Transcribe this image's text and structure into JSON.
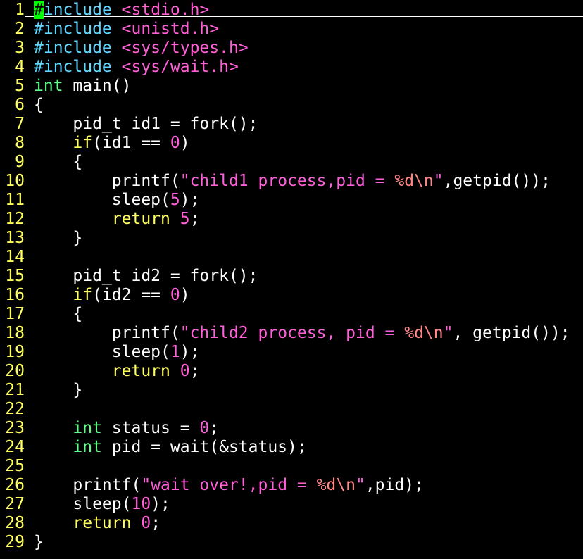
{
  "editor": {
    "colors": {
      "background": "#000000",
      "line_number": "#ffff5f",
      "plain": "#ffffff",
      "preproc": "#5fd7ff",
      "include_path": "#ff5fd7",
      "type": "#5fff87",
      "keyword": "#ffff5f",
      "number": "#ff5fd7",
      "string": "#ff5fd7",
      "special_char": "#ff8787",
      "cursor": "#00ff00"
    },
    "cursor": {
      "line": 1,
      "column": 1
    },
    "lines": [
      {
        "num": "1",
        "tokens": [
          {
            "t": "#",
            "c": "cursor"
          },
          {
            "t": "include",
            "c": "preproc"
          },
          {
            "t": " ",
            "c": "plain"
          },
          {
            "t": "<stdio.h>",
            "c": "include"
          }
        ]
      },
      {
        "num": "2",
        "tokens": [
          {
            "t": "#include",
            "c": "preproc"
          },
          {
            "t": " ",
            "c": "plain"
          },
          {
            "t": "<unistd.h>",
            "c": "include"
          }
        ]
      },
      {
        "num": "3",
        "tokens": [
          {
            "t": "#include",
            "c": "preproc"
          },
          {
            "t": " ",
            "c": "plain"
          },
          {
            "t": "<sys/types.h>",
            "c": "include"
          }
        ]
      },
      {
        "num": "4",
        "tokens": [
          {
            "t": "#include",
            "c": "preproc"
          },
          {
            "t": " ",
            "c": "plain"
          },
          {
            "t": "<sys/wait.h>",
            "c": "include"
          }
        ]
      },
      {
        "num": "5",
        "tokens": [
          {
            "t": "int",
            "c": "type"
          },
          {
            "t": " main()",
            "c": "plain"
          }
        ]
      },
      {
        "num": "6",
        "tokens": [
          {
            "t": "{",
            "c": "plain"
          }
        ]
      },
      {
        "num": "7",
        "tokens": [
          {
            "t": "    pid_t id1 = fork();",
            "c": "plain"
          }
        ]
      },
      {
        "num": "8",
        "tokens": [
          {
            "t": "    ",
            "c": "plain"
          },
          {
            "t": "if",
            "c": "keyword"
          },
          {
            "t": "(id1 == ",
            "c": "plain"
          },
          {
            "t": "0",
            "c": "number"
          },
          {
            "t": ")",
            "c": "plain"
          }
        ]
      },
      {
        "num": "9",
        "tokens": [
          {
            "t": "    {",
            "c": "plain"
          }
        ]
      },
      {
        "num": "10",
        "tokens": [
          {
            "t": "        printf(",
            "c": "plain"
          },
          {
            "t": "\"child1 process,pid = ",
            "c": "string"
          },
          {
            "t": "%d\\n",
            "c": "special"
          },
          {
            "t": "\"",
            "c": "string"
          },
          {
            "t": ",getpid());",
            "c": "plain"
          }
        ]
      },
      {
        "num": "11",
        "tokens": [
          {
            "t": "        sleep(",
            "c": "plain"
          },
          {
            "t": "5",
            "c": "number"
          },
          {
            "t": ");",
            "c": "plain"
          }
        ]
      },
      {
        "num": "12",
        "tokens": [
          {
            "t": "        ",
            "c": "plain"
          },
          {
            "t": "return",
            "c": "keyword"
          },
          {
            "t": " ",
            "c": "plain"
          },
          {
            "t": "5",
            "c": "number"
          },
          {
            "t": ";",
            "c": "plain"
          }
        ]
      },
      {
        "num": "13",
        "tokens": [
          {
            "t": "    }",
            "c": "plain"
          }
        ]
      },
      {
        "num": "14",
        "tokens": []
      },
      {
        "num": "15",
        "tokens": [
          {
            "t": "    pid_t id2 = fork();",
            "c": "plain"
          }
        ]
      },
      {
        "num": "16",
        "tokens": [
          {
            "t": "    ",
            "c": "plain"
          },
          {
            "t": "if",
            "c": "keyword"
          },
          {
            "t": "(id2 == ",
            "c": "plain"
          },
          {
            "t": "0",
            "c": "number"
          },
          {
            "t": ")",
            "c": "plain"
          }
        ]
      },
      {
        "num": "17",
        "tokens": [
          {
            "t": "    {",
            "c": "plain"
          }
        ]
      },
      {
        "num": "18",
        "tokens": [
          {
            "t": "        printf(",
            "c": "plain"
          },
          {
            "t": "\"child2 process, pid = ",
            "c": "string"
          },
          {
            "t": "%d\\n",
            "c": "special"
          },
          {
            "t": "\"",
            "c": "string"
          },
          {
            "t": ", getpid());",
            "c": "plain"
          }
        ]
      },
      {
        "num": "19",
        "tokens": [
          {
            "t": "        sleep(",
            "c": "plain"
          },
          {
            "t": "1",
            "c": "number"
          },
          {
            "t": ");",
            "c": "plain"
          }
        ]
      },
      {
        "num": "20",
        "tokens": [
          {
            "t": "        ",
            "c": "plain"
          },
          {
            "t": "return",
            "c": "keyword"
          },
          {
            "t": " ",
            "c": "plain"
          },
          {
            "t": "0",
            "c": "number"
          },
          {
            "t": ";",
            "c": "plain"
          }
        ]
      },
      {
        "num": "21",
        "tokens": [
          {
            "t": "    }",
            "c": "plain"
          }
        ]
      },
      {
        "num": "22",
        "tokens": []
      },
      {
        "num": "23",
        "tokens": [
          {
            "t": "    ",
            "c": "plain"
          },
          {
            "t": "int",
            "c": "type"
          },
          {
            "t": " status = ",
            "c": "plain"
          },
          {
            "t": "0",
            "c": "number"
          },
          {
            "t": ";",
            "c": "plain"
          }
        ]
      },
      {
        "num": "24",
        "tokens": [
          {
            "t": "    ",
            "c": "plain"
          },
          {
            "t": "int",
            "c": "type"
          },
          {
            "t": " pid = wait(&status);",
            "c": "plain"
          }
        ]
      },
      {
        "num": "25",
        "tokens": []
      },
      {
        "num": "26",
        "tokens": [
          {
            "t": "    printf(",
            "c": "plain"
          },
          {
            "t": "\"wait over!,pid = ",
            "c": "string"
          },
          {
            "t": "%d\\n",
            "c": "special"
          },
          {
            "t": "\"",
            "c": "string"
          },
          {
            "t": ",pid);",
            "c": "plain"
          }
        ]
      },
      {
        "num": "27",
        "tokens": [
          {
            "t": "    sleep(",
            "c": "plain"
          },
          {
            "t": "10",
            "c": "number"
          },
          {
            "t": ");",
            "c": "plain"
          }
        ]
      },
      {
        "num": "28",
        "tokens": [
          {
            "t": "    ",
            "c": "plain"
          },
          {
            "t": "return",
            "c": "keyword"
          },
          {
            "t": " ",
            "c": "plain"
          },
          {
            "t": "0",
            "c": "number"
          },
          {
            "t": ";",
            "c": "plain"
          }
        ]
      },
      {
        "num": "29",
        "tokens": [
          {
            "t": "}",
            "c": "plain"
          }
        ]
      }
    ]
  }
}
